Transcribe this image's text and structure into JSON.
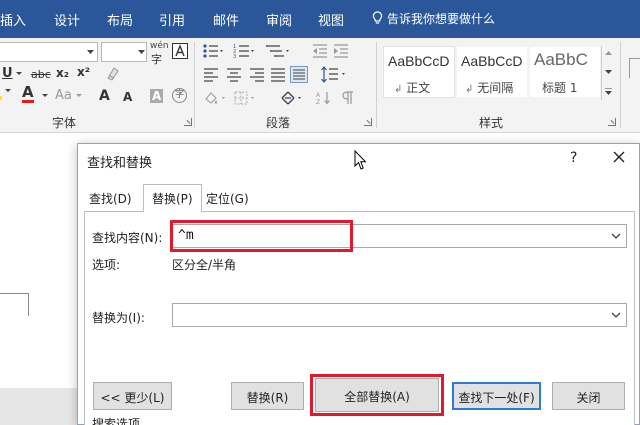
{
  "tabs": {
    "insert": "插入",
    "design": "设计",
    "layout": "布局",
    "references": "引用",
    "mailings": "邮件",
    "review": "审阅",
    "view": "视图",
    "tell_me": "告诉我你想要做什么"
  },
  "ribbon": {
    "font_group_label": "字体",
    "paragraph_group_label": "段落",
    "styles_group_label": "样式",
    "wen_label": "wén",
    "underline": "U",
    "strike": "abc",
    "subscript": "x₂",
    "superscript": "x²",
    "font_color": "A",
    "highlight_case": "Aa",
    "grow_font": "A",
    "shrink_font": "A",
    "char_shade": "A",
    "enclose": "字",
    "styles": [
      {
        "sample": "AaBbCcD",
        "name": "正文"
      },
      {
        "sample": "AaBbCcD",
        "name": "无间隔"
      },
      {
        "sample": "AaBbC",
        "name": "标题 1"
      }
    ],
    "style_marker": "↲",
    "colors": {
      "tab_bar": "#2b579a",
      "font_red": "#e02020",
      "highlight_yellow": "#ffe800"
    }
  },
  "dialog": {
    "title": "查找和替换",
    "help": "?",
    "tabs": {
      "find": "查找(D)",
      "replace": "替换(P)",
      "goto": "定位(G)"
    },
    "find_label": "查找内容(N):",
    "find_value": "^m",
    "options_label": "选项:",
    "options_value": "区分全/半角",
    "replace_label": "替换为(I):",
    "replace_value": "",
    "buttons": {
      "less": "<< 更少(L)",
      "replace": "替换(R)",
      "replace_all": "全部替换(A)",
      "find_next": "查找下一处(F)",
      "close": "关闭"
    },
    "search_options_label": "搜索选项",
    "highlight_color": "#e0192c"
  }
}
